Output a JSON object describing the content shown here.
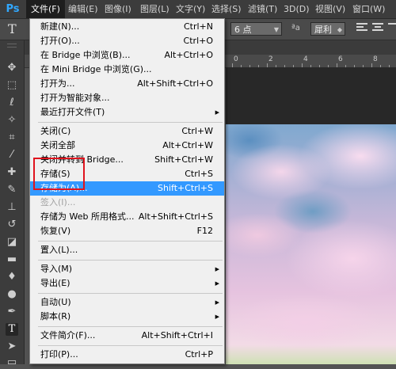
{
  "app": {
    "logo": "Ps"
  },
  "menubar": {
    "items": [
      {
        "label": "文件(F)"
      },
      {
        "label": "编辑(E)"
      },
      {
        "label": "图像(I)"
      },
      {
        "label": "图层(L)"
      },
      {
        "label": "文字(Y)"
      },
      {
        "label": "选择(S)"
      },
      {
        "label": "滤镜(T)"
      },
      {
        "label": "3D(D)"
      },
      {
        "label": "视图(V)"
      },
      {
        "label": "窗口(W)"
      }
    ]
  },
  "options_bar": {
    "tool_glyph": "T",
    "font_size": "6 点",
    "aa_label": "ªa",
    "antialias": "犀利"
  },
  "ruler": {
    "labels": [
      "0",
      "2",
      "4",
      "6",
      "8"
    ]
  },
  "file_menu": {
    "items": [
      {
        "label": "新建(N)...",
        "shortcut": "Ctrl+N"
      },
      {
        "label": "打开(O)...",
        "shortcut": "Ctrl+O"
      },
      {
        "label": "在 Bridge 中浏览(B)...",
        "shortcut": "Alt+Ctrl+O"
      },
      {
        "label": "在 Mini Bridge 中浏览(G)...",
        "shortcut": ""
      },
      {
        "label": "打开为...",
        "shortcut": "Alt+Shift+Ctrl+O"
      },
      {
        "label": "打开为智能对象...",
        "shortcut": ""
      },
      {
        "label": "最近打开文件(T)",
        "shortcut": ""
      },
      {
        "label": "关闭(C)",
        "shortcut": "Ctrl+W"
      },
      {
        "label": "关闭全部",
        "shortcut": "Alt+Ctrl+W"
      },
      {
        "label": "关闭并转到 Bridge...",
        "shortcut": "Shift+Ctrl+W"
      },
      {
        "label": "存储(S)",
        "shortcut": "Ctrl+S"
      },
      {
        "label": "存储为(A)...",
        "shortcut": "Shift+Ctrl+S"
      },
      {
        "label": "签入(I)...",
        "shortcut": ""
      },
      {
        "label": "存储为 Web 所用格式...",
        "shortcut": "Alt+Shift+Ctrl+S"
      },
      {
        "label": "恢复(V)",
        "shortcut": "F12"
      },
      {
        "label": "置入(L)...",
        "shortcut": ""
      },
      {
        "label": "导入(M)",
        "shortcut": ""
      },
      {
        "label": "导出(E)",
        "shortcut": ""
      },
      {
        "label": "自动(U)",
        "shortcut": ""
      },
      {
        "label": "脚本(R)",
        "shortcut": ""
      },
      {
        "label": "文件简介(F)...",
        "shortcut": "Alt+Shift+Ctrl+I"
      },
      {
        "label": "打印(P)...",
        "shortcut": "Ctrl+P"
      }
    ]
  },
  "icons": {
    "move": "move-icon",
    "marquee": "marquee-icon",
    "lasso": "lasso-icon",
    "magic_wand": "magic-wand-icon",
    "crop": "crop-icon",
    "eyedropper": "eyedropper-icon",
    "healing": "healing-brush-icon",
    "brush": "brush-icon",
    "clone": "clone-stamp-icon",
    "history": "history-brush-icon",
    "eraser": "eraser-icon",
    "gradient": "gradient-icon",
    "blur": "blur-icon",
    "dodge": "dodge-icon",
    "pen": "pen-icon",
    "type": "type-icon",
    "path_select": "path-selection-icon",
    "shape": "shape-icon"
  },
  "colors": {
    "highlight": "#3399ff",
    "annotation_box": "#e0141e",
    "photoshop_blue": "#31a8ff"
  }
}
